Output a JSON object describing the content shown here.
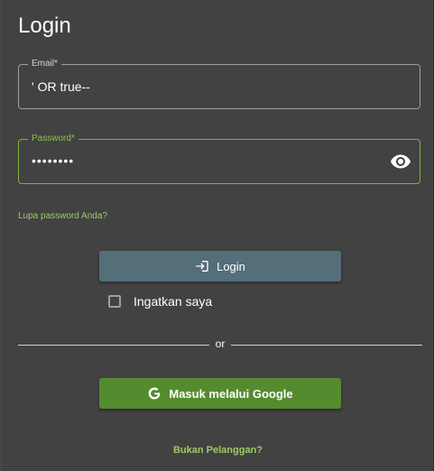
{
  "title": "Login",
  "email": {
    "label": "Email*",
    "value": "' OR true--"
  },
  "password": {
    "label": "Password*",
    "value": "••••••••"
  },
  "forgot_password": "Lupa password Anda?",
  "login_button": {
    "label": "Login",
    "icon": "login-icon"
  },
  "remember_me": {
    "label": "Ingatkan saya",
    "checked": false
  },
  "divider_text": "or",
  "google_button": {
    "label": "Masuk melalui Google",
    "icon": "google-icon"
  },
  "not_customer": "Bukan Pelanggan?",
  "colors": {
    "background": "#424242",
    "accent": "#8bc34a",
    "login_button": "#546e7a",
    "google_button": "#558b2f"
  }
}
